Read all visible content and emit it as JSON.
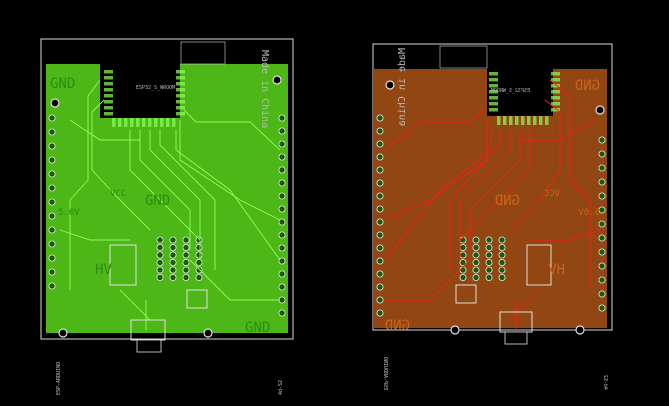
{
  "colors": {
    "background": "#000000",
    "top_copper": "#52c718",
    "top_trace": "#8dff5a",
    "bottom_copper": "#9a4a12",
    "bottom_trace": "#ff1a1a",
    "outline": "#d8d8d8",
    "silk": "#c8c8c8",
    "pad": "#1a5a0a",
    "module": "#000000"
  },
  "boards": [
    {
      "side": "top",
      "module_label": "ESP32_S_WROOM",
      "labels": {
        "gnd_top": "GND",
        "gnd_mid": "GND",
        "gnd_bottom": "GND",
        "vcc": "VCC",
        "v5": "5.0V",
        "hv": "HV",
        "fabrication": "Made in China",
        "bottom_edge_a": "ESP-ARDUINO",
        "bottom_edge_b": "4d-S2"
      }
    },
    {
      "side": "bottom",
      "module_label": "ESP32_S_WROOM",
      "labels": {
        "gnd_top": "GND",
        "gnd_mid": "GND",
        "gnd_bottom": "GND",
        "vcc": "VCC",
        "v5": "5.0V",
        "hv": "HV",
        "fabrication": "Made in China",
        "bottom_edge_a": "ESP-ARDUINO",
        "bottom_edge_b": "4d-S2"
      }
    }
  ]
}
